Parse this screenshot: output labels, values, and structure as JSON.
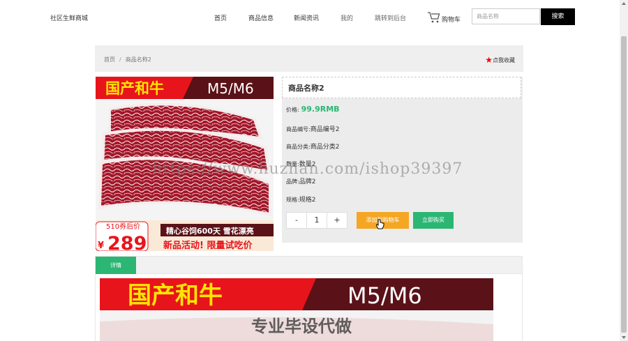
{
  "header": {
    "brand": "社区生鲜商城",
    "nav": [
      "首页",
      "商品信息",
      "新闻资讯",
      "我的",
      "跳转到后台"
    ],
    "cart_label": "购物车",
    "search_placeholder": "商品名称",
    "search_button": "搜索"
  },
  "breadcrumb": {
    "home": "首页",
    "sep": "/",
    "current": "商品名称2"
  },
  "favorite": {
    "star": "★",
    "label": "点我收藏"
  },
  "product": {
    "banner_title": "国产和牛",
    "banner_grade": "M5/M6",
    "coupon": "510券后价",
    "currency": "¥",
    "promo_price": "289",
    "slogan1": "精心谷饲600天 雪花漂亮",
    "slogan2": "新品活动! 限量试吃价"
  },
  "info": {
    "name": "商品名称2",
    "price_label": "价格:",
    "price": "99.9RMB",
    "code_label": "商品编号:",
    "code": "商品编号2",
    "category_label": "商品分类:",
    "category": "商品分类2",
    "count_label": "数量:",
    "count": "数量2",
    "brand_label": "品牌:",
    "brand": "品牌2",
    "spec_label": "规格:",
    "spec": "规格2",
    "minus": "-",
    "qty": "1",
    "plus": "+",
    "add_to_cart": "添加到购物车",
    "buy_now": "立即购买"
  },
  "tabs": {
    "detail": "详情"
  },
  "watermarks": {
    "site": "https://www.huzhan.com/ishop39397",
    "caption": "专业毕设代做"
  },
  "colors": {
    "accent": "#2bb673",
    "cart_btn": "#f5a623",
    "banner_red": "#e8141b",
    "banner_yellow": "#ffe600"
  }
}
